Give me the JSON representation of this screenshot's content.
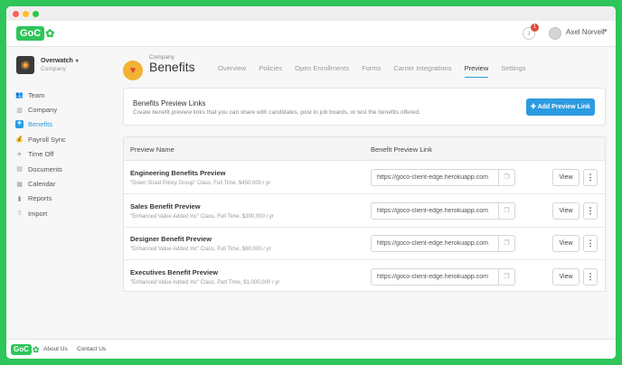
{
  "app": {
    "logo_main": "GoC",
    "logo_tail": "✿"
  },
  "header": {
    "notification_count": "1",
    "user_name": "Axel Norvell"
  },
  "org": {
    "name": "Overwatch",
    "subtitle": "Company"
  },
  "sidebar": {
    "items": [
      {
        "label": "Team",
        "icon": "team-icon",
        "glyph": "👥"
      },
      {
        "label": "Company",
        "icon": "building-icon",
        "glyph": "▥"
      },
      {
        "label": "Benefits",
        "icon": "benefits-icon",
        "glyph": "✚"
      },
      {
        "label": "Payroll Sync",
        "icon": "payroll-icon",
        "glyph": "💰"
      },
      {
        "label": "Time Off",
        "icon": "plane-icon",
        "glyph": "✈"
      },
      {
        "label": "Documents",
        "icon": "document-icon",
        "glyph": "▤"
      },
      {
        "label": "Calendar",
        "icon": "calendar-icon",
        "glyph": "▦"
      },
      {
        "label": "Reports",
        "icon": "chart-icon",
        "glyph": "▮"
      },
      {
        "label": "Import",
        "icon": "upload-icon",
        "glyph": "⇧"
      }
    ],
    "active_index": 2
  },
  "page": {
    "crumb": "Company",
    "title": "Benefits",
    "tabs": [
      "Overview",
      "Policies",
      "Open Enrollments",
      "Forms",
      "Carrier Integrations",
      "Preview",
      "Settings"
    ],
    "active_tab": "Preview"
  },
  "preview_links": {
    "title": "Benefits Preview Links",
    "description": "Create benefit preview links that you can share with candidates, post to job boards, or test the benefits offered.",
    "add_button": "Add Preview Link"
  },
  "table": {
    "col_name": "Preview Name",
    "col_link": "Benefit Preview Link",
    "view_label": "View",
    "rows": [
      {
        "name": "Engineering Benefits Preview",
        "desc": "\"Down Sized Policy Group\" Class, Full Time, $450,000 / yr",
        "link": "https://goco-client-edge.herokuapp.com"
      },
      {
        "name": "Sales Benefit Preview",
        "desc": "\"Enhanced Value Added Inc\" Class, Full Time, $300,000 / yr",
        "link": "https://goco-client-edge.herokuapp.com"
      },
      {
        "name": "Designer Benefit Preview",
        "desc": "\"Enhanced Value Added Inc\" Class, Full Time, $60,000 / yr",
        "link": "https://goco-client-edge.herokuapp.com"
      },
      {
        "name": "Executives Benefit Preview",
        "desc": "\"Enhanced Value Added Inc\" Class, Part Time, $1,000,000 / yr",
        "link": "https://goco-client-edge.herokuapp.com"
      }
    ]
  },
  "footer": {
    "about": "About Us",
    "contact": "Contact Us"
  },
  "colors": {
    "brand": "#2ec55a",
    "accent": "#2d9be0",
    "notification": "#e04a3f"
  }
}
